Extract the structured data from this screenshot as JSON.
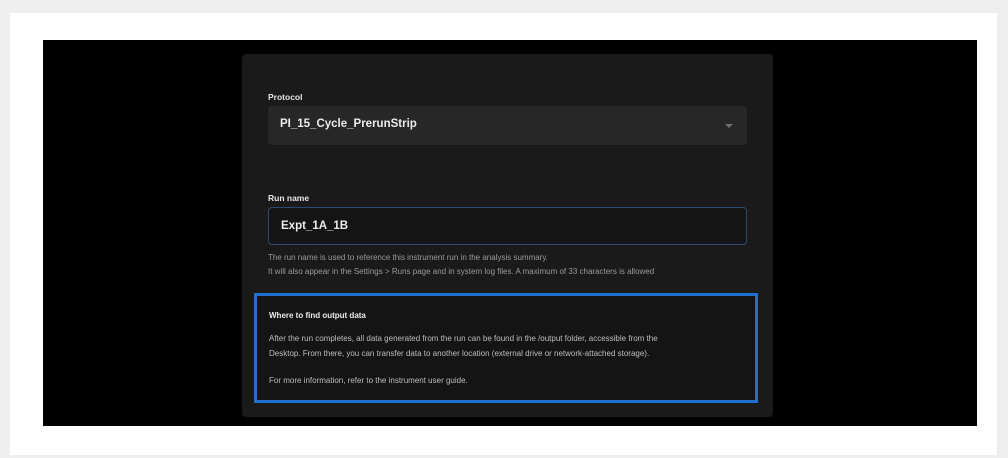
{
  "protocol": {
    "label": "Protocol",
    "selected_value": "PI_15_Cycle_PrerunStrip",
    "caret_icon": "chevron-down-icon"
  },
  "run_name": {
    "label": "Run name",
    "value": "Expt_1A_1B",
    "helper_line_1": "The run name is used to reference this instrument run in the analysis summary.",
    "helper_line_2": "It will also appear in the Settings > Runs page and in system log files. A maximum of 33 characters is allowed"
  },
  "output_info": {
    "title": "Where to find output data",
    "line_1": "After the run completes, all data generated from the run can be found in the /output folder, accessible from the",
    "line_2": "Desktop. From there, you can transfer data to another location (external drive or network-attached storage).",
    "line_3": "For more information, refer to the instrument user guide."
  },
  "colors": {
    "highlight_border": "#1e6fd0",
    "panel_background": "#1a1a1a",
    "screen_background": "#000000"
  }
}
